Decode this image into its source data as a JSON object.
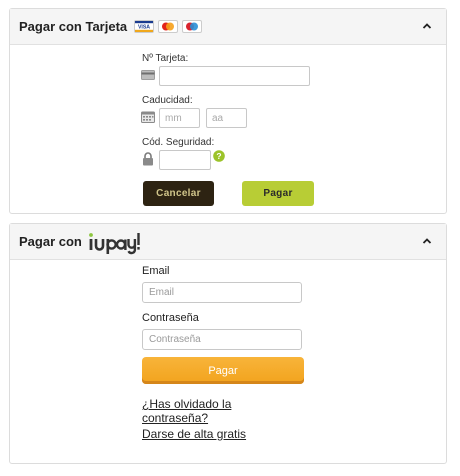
{
  "card_section": {
    "title": "Pagar con Tarjeta",
    "card_logos": [
      "visa-logo",
      "mastercard-logo",
      "maestro-logo"
    ],
    "card_number_label": "Nº Tarjeta:",
    "card_number_value": "",
    "expiry_label": "Caducidad:",
    "expiry_month_placeholder": "mm",
    "expiry_year_placeholder": "aa",
    "cvv_label": "Cód. Seguridad:",
    "cvv_value": "",
    "cancel_label": "Cancelar",
    "pay_label": "Pagar"
  },
  "iupay_section": {
    "title": "Pagar con",
    "email_label": "Email",
    "email_placeholder": "Email",
    "password_label": "Contraseña",
    "password_placeholder": "Contraseña",
    "pay_label": "Pagar",
    "forgot_line1": "¿Has olvidado la",
    "forgot_line2": "contraseña?",
    "signup_link": "Darse de alta gratis"
  },
  "colors": {
    "cancel_bg": "#2d2312",
    "pay_card_bg": "#b8cd35",
    "pay_iupay_bg": "#f5a623",
    "iupay_dot": "#8dc63f"
  }
}
